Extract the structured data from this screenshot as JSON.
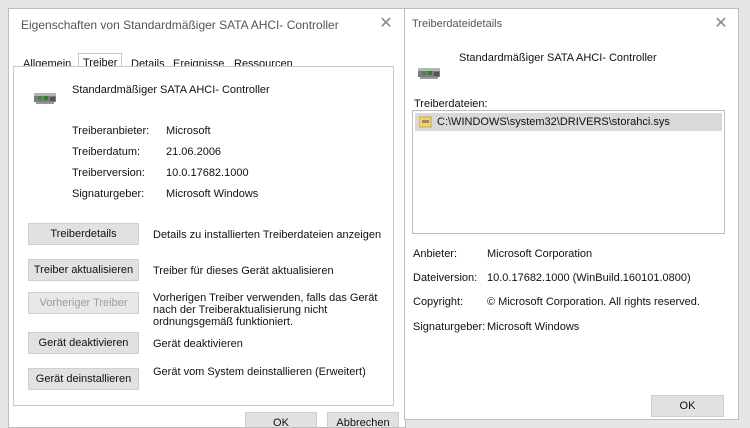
{
  "props": {
    "title": "Eigenschaften von Standardmäßiger SATA AHCI- Controller",
    "close": "✕",
    "tabs": [
      "Allgemein",
      "Treiber",
      "Details",
      "Ereignisse",
      "Ressourcen"
    ],
    "active_tab": "Treiber",
    "device_name": "Standardmäßiger SATA AHCI- Controller",
    "info": [
      {
        "label": "Treiberanbieter:",
        "value": "Microsoft"
      },
      {
        "label": "Treiberdatum:",
        "value": "21.06.2006"
      },
      {
        "label": "Treiberversion:",
        "value": "10.0.17682.1000"
      },
      {
        "label": "Signaturgeber:",
        "value": "Microsoft Windows"
      }
    ],
    "actions": [
      {
        "button": "Treiberdetails",
        "desc": "Details zu installierten Treiberdateien anzeigen"
      },
      {
        "button": "Treiber aktualisieren",
        "desc": "Treiber für dieses Gerät aktualisieren"
      },
      {
        "button": "Vorheriger Treiber",
        "desc": "Vorherigen Treiber verwenden, falls das Gerät nach der Treiberaktualisierung nicht ordnungsgemäß funktioniert."
      },
      {
        "button": "Gerät deaktivieren",
        "desc": "Gerät deaktivieren"
      },
      {
        "button": "Gerät deinstallieren",
        "desc": "Gerät vom System deinstallieren (Erweitert)"
      }
    ],
    "ok": "OK",
    "cancel": "Abbrechen"
  },
  "details": {
    "title": "Treiberdateidetails",
    "close": "✕",
    "device_name": "Standardmäßiger SATA AHCI- Controller",
    "files_label": "Treiberdateien:",
    "files": [
      "C:\\WINDOWS\\system32\\DRIVERS\\storahci.sys"
    ],
    "info": [
      {
        "label": "Anbieter:",
        "value": "Microsoft Corporation"
      },
      {
        "label": "Dateiversion:",
        "value": "10.0.17682.1000 (WinBuild.160101.0800)"
      },
      {
        "label": "Copyright:",
        "value": "© Microsoft Corporation. All rights reserved."
      },
      {
        "label": "Signaturgeber:",
        "value": "Microsoft Windows"
      }
    ],
    "ok": "OK"
  }
}
